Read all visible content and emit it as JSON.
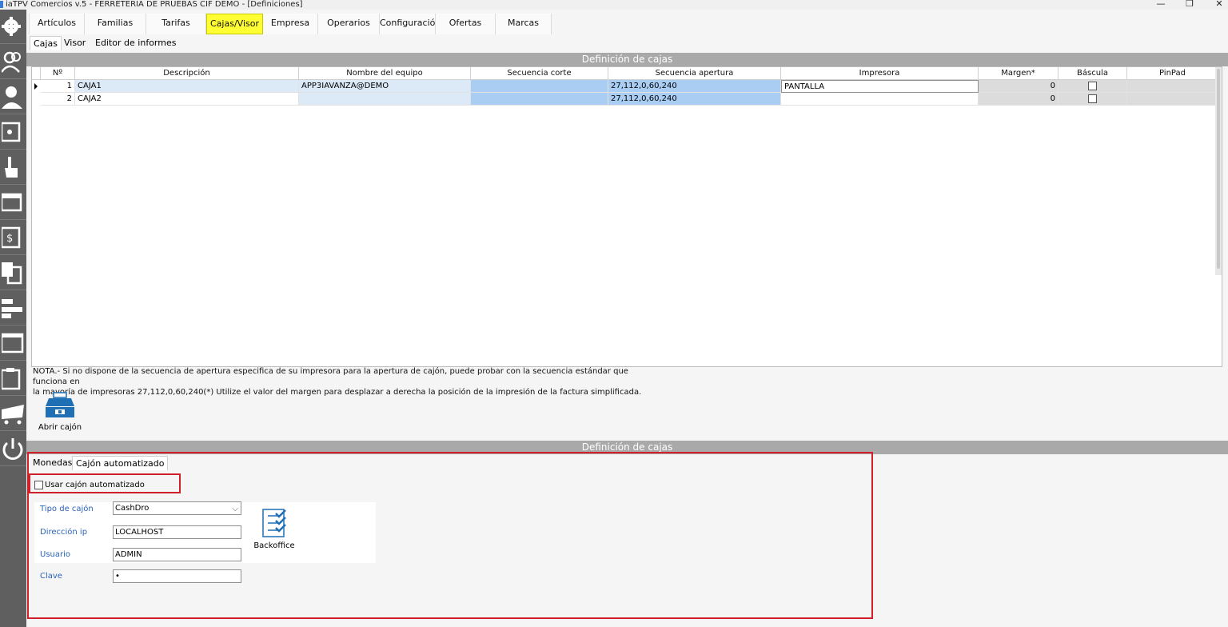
{
  "window": {
    "title": "iaTPV Comercios v.5 - FERRETERIA DE PRUEBAS CIF DEMO - [Definiciones]",
    "minimize": "—",
    "restore": "❐",
    "close": "✕"
  },
  "sidebar": {
    "items": [
      "gear-icon",
      "users-icon",
      "user-icon",
      "safe-icon",
      "hand-pointer-icon",
      "browser-window-icon",
      "cash-register-icon",
      "documents-icon",
      "layout-icon",
      "window-icon",
      "clipboard-icon",
      "cart-icon",
      "power-icon"
    ]
  },
  "menu": {
    "tabs": [
      "Artículos",
      "Familias",
      "Tarifas",
      "Cajas/Visor",
      "Empresa",
      "Operarios",
      "Configuración",
      "Ofertas",
      "Marcas"
    ],
    "active": "Cajas/Visor",
    "active_color": "#ffff33"
  },
  "subtabs": {
    "items": [
      "Cajas",
      "Visor",
      "Editor de informes"
    ],
    "active": "Cajas"
  },
  "cajas_section": {
    "header": "Definición de cajas",
    "columns": [
      "Nº",
      "Descripción",
      "Nombre del equipo",
      "Secuencia corte",
      "Secuencia apertura",
      "Impresora",
      "Margen*",
      "Báscula",
      "PinPad"
    ],
    "rows": [
      {
        "num": "1",
        "descripcion": "CAJA1",
        "equipo": "APP3IAVANZA@DEMO",
        "corte": "",
        "apertura": "27,112,0,60,240",
        "impresora": "PANTALLA",
        "margen": "0",
        "bascula": false,
        "pinpad": ""
      },
      {
        "num": "2",
        "descripcion": "CAJA2",
        "equipo": "",
        "corte": "",
        "apertura": "27,112,0,60,240",
        "impresora": "",
        "margen": "0",
        "bascula": false,
        "pinpad": ""
      }
    ]
  },
  "note": {
    "line1": "NOTA.- Si no dispone de la secuencia de apertura especifica de su impresora para la apertura de cajón, puede probar con la secuencia estándar que funciona en",
    "line2": "la mayoría de impresoras 27,112,0,60,240(*) Utilize el valor del margen  para desplazar a derecha la posición de la impresión de la factura simplificada."
  },
  "abrir_cajon": {
    "label": "Abrir cajón",
    "icon": "cash-drawer-icon"
  },
  "bottom_section": {
    "header": "Definición de cajas",
    "tabs": [
      "Monedas",
      "Cajón automatizado"
    ],
    "active": "Cajón automatizado",
    "use_auto_label": "Usar cajón automatizado",
    "use_auto_checked": false,
    "fields": {
      "tipo_label": "Tipo de cajón",
      "tipo_value": "CashDro",
      "ip_label": "Dirección ip",
      "ip_value": "LOCALHOST",
      "usuario_label": "Usuario",
      "usuario_value": "ADMIN",
      "clave_label": "Clave",
      "clave_value": "•"
    },
    "backoffice_label": "Backoffice",
    "highlight_color": "#d0202a"
  }
}
